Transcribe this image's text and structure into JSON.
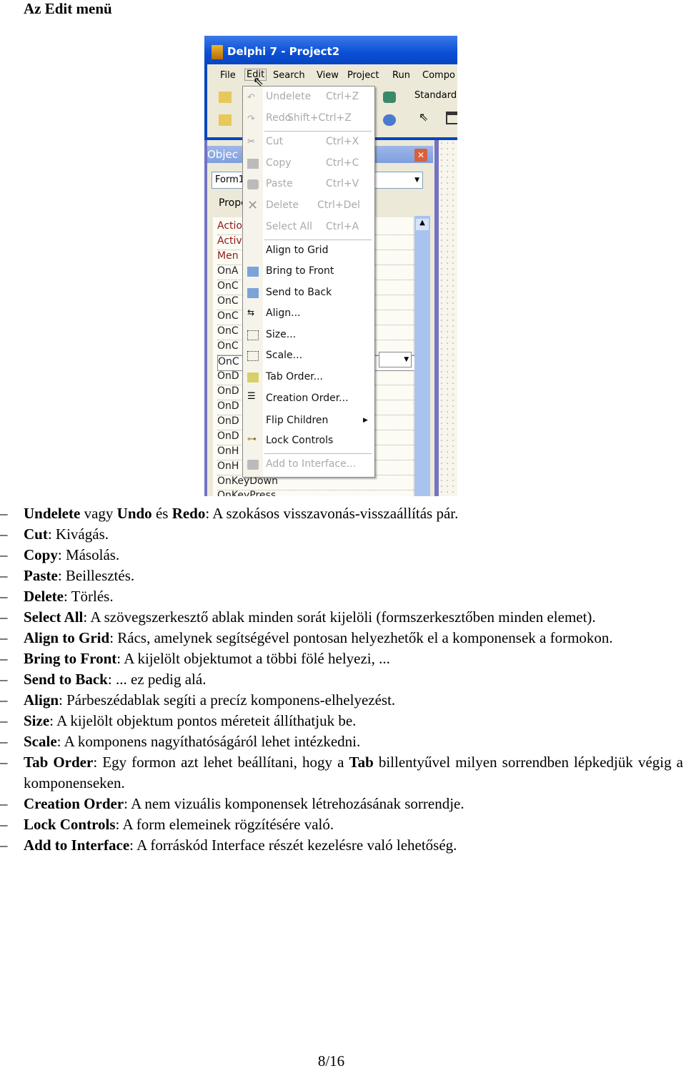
{
  "heading": "Az Edit menü",
  "screenshot": {
    "title": "Delphi 7 - Project2",
    "menubar": [
      "File",
      "Edit",
      "Search",
      "View",
      "Project",
      "Run",
      "Compo"
    ],
    "palette_tab": "Standard",
    "inspector": {
      "title": "Objec",
      "combo": "Form1",
      "tab": "Prope",
      "rows": [
        "Actio",
        "Activ",
        "Men",
        "OnA",
        "OnC",
        "OnC",
        "OnC",
        "OnC",
        "OnC",
        "OnC",
        "OnD",
        "OnD",
        "OnD",
        "OnD",
        "OnD",
        "OnH",
        "OnH",
        "OnKeyDown",
        "OnKeyPress"
      ]
    },
    "edit_menu": [
      {
        "label": "Undelete",
        "shortcut": "Ctrl+Z",
        "enabled": false,
        "icon": "undo-icon"
      },
      {
        "label": "Redo",
        "shortcut": "Shift+Ctrl+Z",
        "enabled": false,
        "icon": "redo-icon"
      },
      {
        "label": "Cut",
        "shortcut": "Ctrl+X",
        "enabled": false,
        "icon": "scissors-icon"
      },
      {
        "label": "Copy",
        "shortcut": "Ctrl+C",
        "enabled": false,
        "icon": "copy-icon"
      },
      {
        "label": "Paste",
        "shortcut": "Ctrl+V",
        "enabled": false,
        "icon": "paste-icon"
      },
      {
        "label": "Delete",
        "shortcut": "Ctrl+Del",
        "enabled": false,
        "icon": "delete-x-icon"
      },
      {
        "label": "Select All",
        "shortcut": "Ctrl+A",
        "enabled": false,
        "icon": ""
      },
      {
        "label": "Align to Grid",
        "shortcut": "",
        "enabled": true,
        "icon": ""
      },
      {
        "label": "Bring to Front",
        "shortcut": "",
        "enabled": true,
        "icon": "bring-front-icon"
      },
      {
        "label": "Send to Back",
        "shortcut": "",
        "enabled": true,
        "icon": "send-back-icon"
      },
      {
        "label": "Align...",
        "shortcut": "",
        "enabled": true,
        "icon": "align-icon"
      },
      {
        "label": "Size...",
        "shortcut": "",
        "enabled": true,
        "icon": "size-icon"
      },
      {
        "label": "Scale...",
        "shortcut": "",
        "enabled": true,
        "icon": "scale-icon"
      },
      {
        "label": "Tab Order...",
        "shortcut": "",
        "enabled": true,
        "icon": "tab-order-icon"
      },
      {
        "label": "Creation Order...",
        "shortcut": "",
        "enabled": true,
        "icon": "creation-order-icon"
      },
      {
        "label": "Flip Children",
        "shortcut": "",
        "enabled": true,
        "icon": "",
        "submenu": true
      },
      {
        "label": "Lock Controls",
        "shortcut": "",
        "enabled": true,
        "icon": "key-icon"
      },
      {
        "label": "Add to Interface...",
        "shortcut": "",
        "enabled": false,
        "icon": "interface-icon"
      }
    ]
  },
  "items": [
    {
      "parts": [
        [
          "b",
          "Undelete"
        ],
        [
          "t",
          " vagy "
        ],
        [
          "b",
          "Undo"
        ],
        [
          "t",
          " és "
        ],
        [
          "b",
          "Redo"
        ],
        [
          "t",
          ": A szokásos visszavonás-visszaállítás pár."
        ]
      ]
    },
    {
      "parts": [
        [
          "b",
          "Cut"
        ],
        [
          "t",
          ": Kivágás."
        ]
      ]
    },
    {
      "parts": [
        [
          "b",
          "Copy"
        ],
        [
          "t",
          ": Másolás."
        ]
      ]
    },
    {
      "parts": [
        [
          "b",
          "Paste"
        ],
        [
          "t",
          ": Beillesztés."
        ]
      ]
    },
    {
      "parts": [
        [
          "b",
          "Delete"
        ],
        [
          "t",
          ": Törlés."
        ]
      ]
    },
    {
      "parts": [
        [
          "b",
          "Select All"
        ],
        [
          "t",
          ": A szövegszerkesztő ablak minden sorát kijelöli (formszerkesztőben minden elemet)."
        ]
      ]
    },
    {
      "parts": [
        [
          "b",
          "Align to Grid"
        ],
        [
          "t",
          ": Rács, amelynek segítségével pontosan helyezhetők el a komponensek a formokon."
        ]
      ]
    },
    {
      "parts": [
        [
          "b",
          "Bring to Front"
        ],
        [
          "t",
          ": A kijelölt objektumot a többi fölé helyezi, ..."
        ]
      ]
    },
    {
      "parts": [
        [
          "b",
          "Send to Back"
        ],
        [
          "t",
          ": ... ez pedig alá."
        ]
      ]
    },
    {
      "parts": [
        [
          "b",
          "Align"
        ],
        [
          "t",
          ": Párbeszédablak segíti a precíz komponens-elhelyezést."
        ]
      ]
    },
    {
      "parts": [
        [
          "b",
          "Size"
        ],
        [
          "t",
          ": A kijelölt objektum pontos méreteit állíthatjuk be."
        ]
      ]
    },
    {
      "parts": [
        [
          "b",
          "Scale"
        ],
        [
          "t",
          ": A komponens nagyíthatóságáról lehet intézkedni."
        ]
      ]
    },
    {
      "parts": [
        [
          "b",
          "Tab Order"
        ],
        [
          "t",
          ": Egy formon azt lehet beállítani, hogy a "
        ],
        [
          "b",
          "Tab"
        ],
        [
          "t",
          " billentyűvel milyen sorrendben lépkedjük végig a komponenseken."
        ]
      ]
    },
    {
      "parts": [
        [
          "b",
          "Creation Order"
        ],
        [
          "t",
          ": A nem vizuális komponensek létrehozásának sorrendje."
        ]
      ]
    },
    {
      "parts": [
        [
          "b",
          "Lock Controls"
        ],
        [
          "t",
          ": A form elemeinek rögzítésére való."
        ]
      ]
    },
    {
      "parts": [
        [
          "b",
          "Add to Interface"
        ],
        [
          "t",
          ": A forráskód Interface részét kezelésre való lehetőség."
        ]
      ]
    }
  ],
  "page_number": "8/16"
}
